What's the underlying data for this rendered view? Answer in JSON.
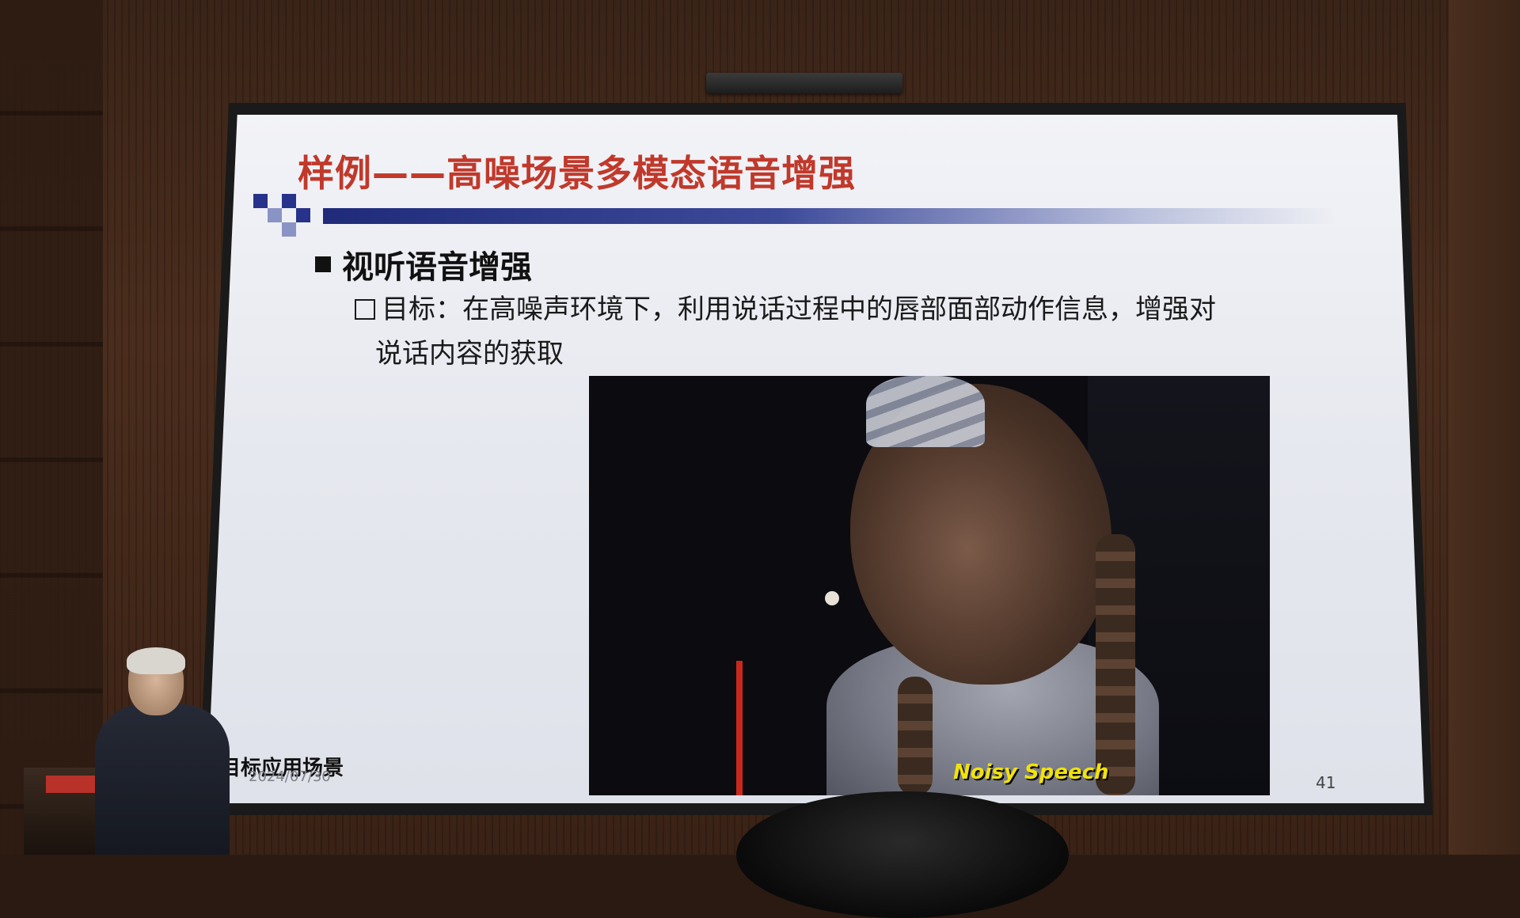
{
  "slide": {
    "title": "样例——高噪场景多模态语音增强",
    "bullet_l1": "视听语音增强",
    "bullet_l2_line1": "目标：在高噪声环境下，利用说话过程中的唇部面部动作信息，增强对",
    "bullet_l2_line2": "说话内容的获取",
    "video_caption": "Noisy Speech",
    "footer_title": "目标应用场景",
    "footer_date": "2024/07/30",
    "page_number": "41"
  },
  "colors": {
    "title": "#c0392b",
    "title_bar": "#1f2b7a",
    "caption": "#f2e20a",
    "wall": "#4a2d1d"
  }
}
